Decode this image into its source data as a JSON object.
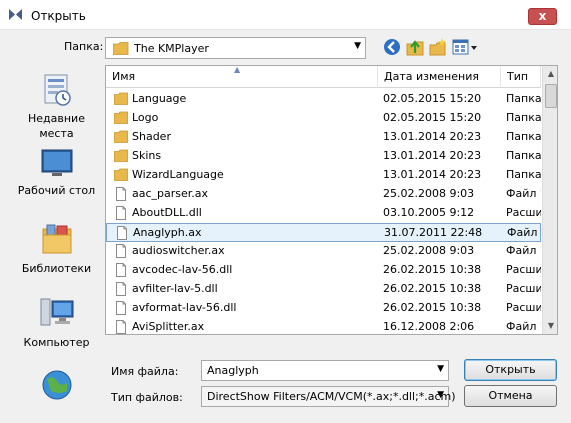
{
  "window": {
    "title": "Открыть",
    "close_label": "x"
  },
  "folder": {
    "label": "Папка:",
    "value": "The KMPlayer"
  },
  "toolbar": {
    "icons": [
      "back-icon",
      "up-folder-icon",
      "new-folder-icon",
      "view-menu-icon"
    ]
  },
  "places": [
    {
      "label": "Недавние места",
      "icon": "recent-places-icon"
    },
    {
      "label": "Рабочий стол",
      "icon": "desktop-icon"
    },
    {
      "label": "Библиотеки",
      "icon": "libraries-icon"
    },
    {
      "label": "Компьютер",
      "icon": "computer-icon"
    },
    {
      "label": "",
      "icon": "network-icon"
    }
  ],
  "columns": {
    "name": "Имя",
    "date": "Дата изменения",
    "type": "Тип"
  },
  "files": [
    {
      "name": "Language",
      "date": "02.05.2015 15:20",
      "type": "Папка",
      "kind": "folder"
    },
    {
      "name": "Logo",
      "date": "02.05.2015 15:20",
      "type": "Папка",
      "kind": "folder"
    },
    {
      "name": "Shader",
      "date": "13.01.2014 20:23",
      "type": "Папка",
      "kind": "folder"
    },
    {
      "name": "Skins",
      "date": "13.01.2014 20:23",
      "type": "Папка",
      "kind": "folder"
    },
    {
      "name": "WizardLanguage",
      "date": "13.01.2014 20:23",
      "type": "Папка",
      "kind": "folder"
    },
    {
      "name": "aac_parser.ax",
      "date": "25.02.2008 9:03",
      "type": "Файл '",
      "kind": "file"
    },
    {
      "name": "AboutDLL.dll",
      "date": "03.10.2005 9:12",
      "type": "Расши",
      "kind": "file"
    },
    {
      "name": "Anaglyph.ax",
      "date": "31.07.2011 22:48",
      "type": "Файл '",
      "kind": "file",
      "selected": true
    },
    {
      "name": "audioswitcher.ax",
      "date": "25.02.2008 9:03",
      "type": "Файл '",
      "kind": "file"
    },
    {
      "name": "avcodec-lav-56.dll",
      "date": "26.02.2015 10:38",
      "type": "Расши",
      "kind": "file"
    },
    {
      "name": "avfilter-lav-5.dll",
      "date": "26.02.2015 10:38",
      "type": "Расши",
      "kind": "file"
    },
    {
      "name": "avformat-lav-56.dll",
      "date": "26.02.2015 10:38",
      "type": "Расши",
      "kind": "file"
    },
    {
      "name": "AviSplitter.ax",
      "date": "16.12.2008 2:06",
      "type": "Файл '",
      "kind": "file"
    }
  ],
  "filename": {
    "label": "Имя файла:",
    "value": "Anaglyph"
  },
  "filetype": {
    "label": "Тип файлов:",
    "value": "DirectShow Filters/ACM/VCM(*.ax;*.dll;*.acm)"
  },
  "buttons": {
    "open": "Открыть",
    "cancel": "Отмена"
  },
  "colors": {
    "folder": "#e8b84a",
    "selection": "#e5f1fb",
    "selection_border": "#7da2ce"
  }
}
